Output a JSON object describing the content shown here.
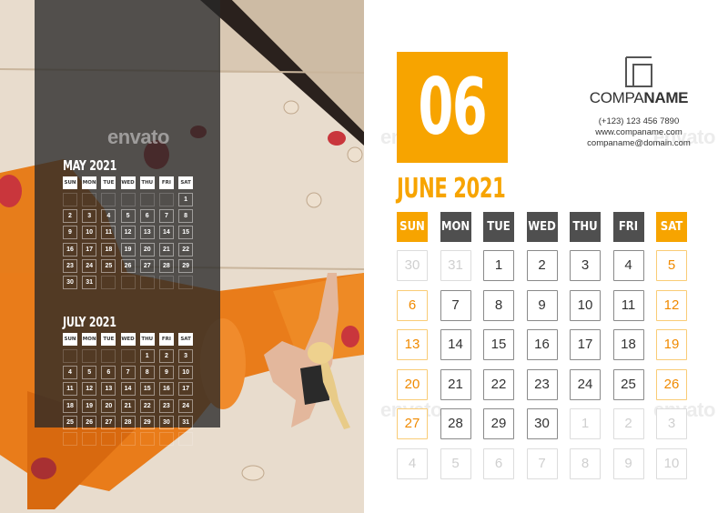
{
  "colors": {
    "accent": "#f7a400",
    "weekday_header": "#4f4f4f",
    "overlay": "#282828"
  },
  "main_month": {
    "number": "06",
    "title": "JUNE 2021",
    "headers": [
      "SUN",
      "MON",
      "TUE",
      "WED",
      "THU",
      "FRI",
      "SAT"
    ],
    "weeks": [
      [
        "30",
        "31",
        "1",
        "2",
        "3",
        "4",
        "5"
      ],
      [
        "6",
        "7",
        "8",
        "9",
        "10",
        "11",
        "12"
      ],
      [
        "13",
        "14",
        "15",
        "16",
        "17",
        "18",
        "19"
      ],
      [
        "20",
        "21",
        "22",
        "23",
        "24",
        "25",
        "26"
      ],
      [
        "27",
        "28",
        "29",
        "30",
        "1",
        "2",
        "3"
      ],
      [
        "4",
        "5",
        "6",
        "7",
        "8",
        "9",
        "10"
      ]
    ],
    "other_month_cells": [
      [
        0,
        0
      ],
      [
        0,
        1
      ],
      [
        4,
        4
      ],
      [
        4,
        5
      ],
      [
        4,
        6
      ],
      [
        5,
        0
      ],
      [
        5,
        1
      ],
      [
        5,
        2
      ],
      [
        5,
        3
      ],
      [
        5,
        4
      ],
      [
        5,
        5
      ],
      [
        5,
        6
      ]
    ]
  },
  "company": {
    "logo_icon": "square-frame-logo-icon",
    "name_light": "COMPA",
    "name_bold": "NAME",
    "phone": "(+123) 123 456 7890",
    "website": "www.companame.com",
    "email": "companame@domain.com"
  },
  "prev_month": {
    "title": "MAY 2021",
    "headers": [
      "SUN",
      "MON",
      "TUE",
      "WED",
      "THU",
      "FRI",
      "SAT"
    ],
    "weeks": [
      [
        "",
        "",
        "",
        "",
        "",
        "",
        "1"
      ],
      [
        "2",
        "3",
        "4",
        "5",
        "6",
        "7",
        "8"
      ],
      [
        "9",
        "10",
        "11",
        "12",
        "13",
        "14",
        "15"
      ],
      [
        "16",
        "17",
        "18",
        "19",
        "20",
        "21",
        "22"
      ],
      [
        "23",
        "24",
        "25",
        "26",
        "27",
        "28",
        "29"
      ],
      [
        "30",
        "31",
        "",
        "",
        "",
        "",
        ""
      ]
    ]
  },
  "next_month": {
    "title": "JULY 2021",
    "headers": [
      "SUN",
      "MON",
      "TUE",
      "WED",
      "THU",
      "FRI",
      "SAT"
    ],
    "weeks": [
      [
        "",
        "",
        "",
        "",
        "1",
        "2",
        "3"
      ],
      [
        "4",
        "5",
        "6",
        "7",
        "8",
        "9",
        "10"
      ],
      [
        "11",
        "12",
        "13",
        "14",
        "15",
        "16",
        "17"
      ],
      [
        "18",
        "19",
        "20",
        "21",
        "22",
        "23",
        "24"
      ],
      [
        "25",
        "26",
        "27",
        "28",
        "29",
        "30",
        "31"
      ],
      [
        "",
        "",
        "",
        "",
        "",
        "",
        ""
      ]
    ]
  },
  "watermark": "envato"
}
